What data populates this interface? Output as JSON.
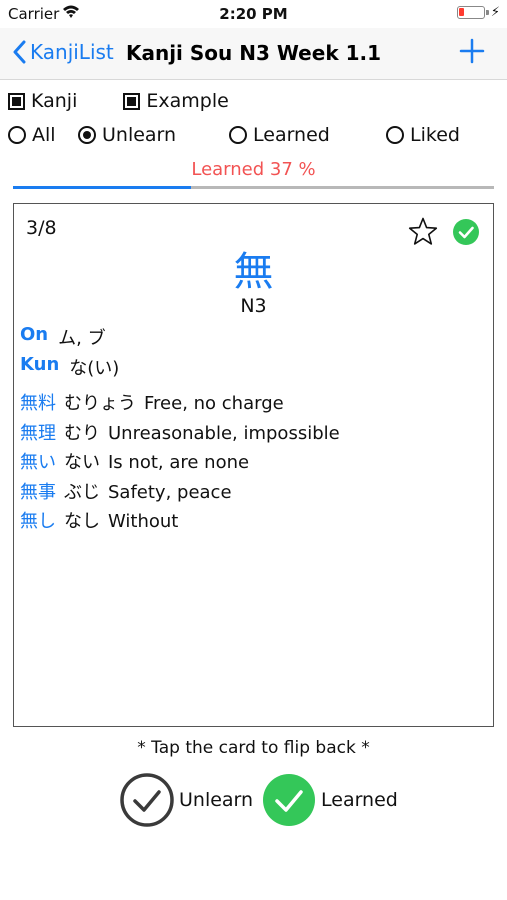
{
  "status_bar": {
    "carrier": "Carrier",
    "time": "2:20 PM"
  },
  "nav": {
    "back_label": "KanjiList",
    "title": "Kanji Sou N3 Week 1.1"
  },
  "display_toggles": [
    {
      "label": "Kanji",
      "checked": true
    },
    {
      "label": "Example",
      "checked": true
    }
  ],
  "filters": [
    {
      "label": "All",
      "selected": false
    },
    {
      "label": "Unlearn",
      "selected": true
    },
    {
      "label": "Learned",
      "selected": false
    },
    {
      "label": "Liked",
      "selected": false
    }
  ],
  "progress": {
    "label": "Learned 37 %",
    "fraction": 0.37
  },
  "card": {
    "counter": "3/8",
    "kanji": "無",
    "level": "N3",
    "on_label": "On",
    "on_reading": "ム, ブ",
    "kun_label": "Kun",
    "kun_reading": "な(い)",
    "examples": [
      {
        "word": "無料",
        "reading": "むりょう",
        "meaning": "Free, no charge"
      },
      {
        "word": "無理",
        "reading": "むり",
        "meaning": "Unreasonable, impossible"
      },
      {
        "word": "無い",
        "reading": "ない",
        "meaning": "Is not, are none"
      },
      {
        "word": "無事",
        "reading": "ぶじ",
        "meaning": "Safety, peace"
      },
      {
        "word": "無し",
        "reading": "なし",
        "meaning": "Without"
      }
    ]
  },
  "hint": "* Tap the card to flip back *",
  "actions": {
    "unlearn_label": "Unlearn",
    "learned_label": "Learned"
  },
  "colors": {
    "accent": "#1a7cf0",
    "progress_text": "#f25353",
    "learned_green": "#34c759"
  }
}
